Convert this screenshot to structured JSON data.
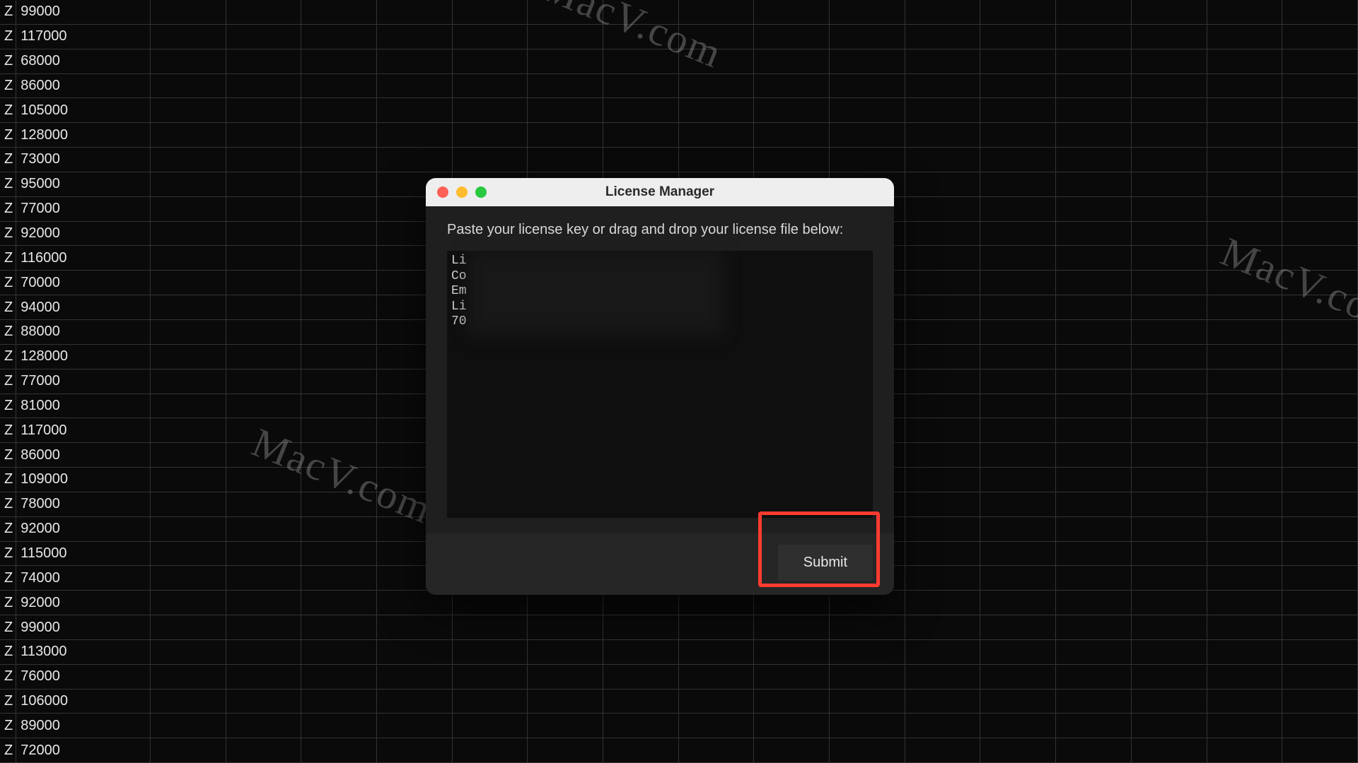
{
  "spreadsheet": {
    "col_a_suffix": "Z",
    "col_b_values": [
      "99000",
      "117000",
      "68000",
      "86000",
      "105000",
      "128000",
      "73000",
      "95000",
      "77000",
      "92000",
      "116000",
      "70000",
      "94000",
      "88000",
      "128000",
      "77000",
      "81000",
      "117000",
      "86000",
      "109000",
      "78000",
      "92000",
      "115000",
      "74000",
      "92000",
      "99000",
      "113000",
      "76000",
      "106000",
      "89000",
      "72000"
    ]
  },
  "dialog": {
    "title": "License Manager",
    "instruction": "Paste your license key or drag and drop your license file below:",
    "license_lines": [
      "Li",
      "Co",
      "Em",
      "Li",
      "70"
    ],
    "submit_label": "Submit"
  },
  "watermark": {
    "text": "MacV.com"
  }
}
